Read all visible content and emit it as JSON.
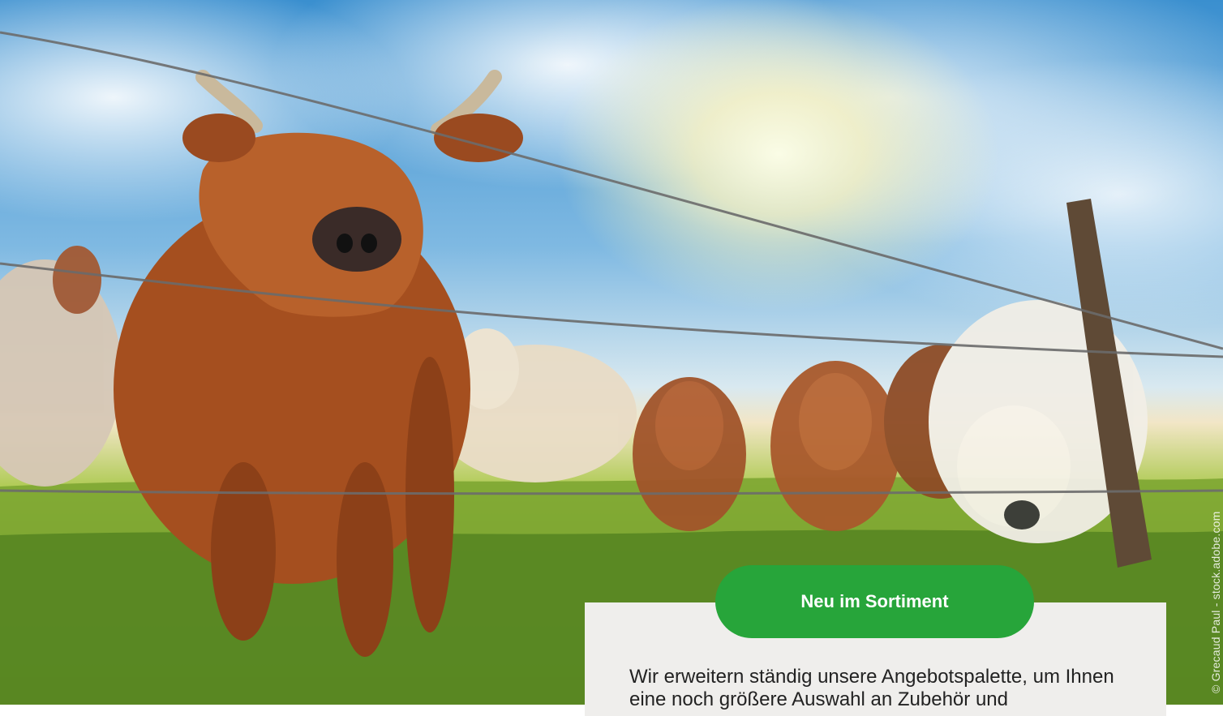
{
  "hero": {
    "image_alt": "Kühe auf einer Weide hinter einem Stacheldrahtzaun bei Sonnenschein",
    "credit": "© Grecaud Paul - stock.adobe.com"
  },
  "badge": {
    "label": "Neu im Sortiment"
  },
  "card": {
    "text": "Wir erweitern ständig unsere Angebotspalette, um Ihnen eine noch größere Auswahl an Zubehör und"
  },
  "colors": {
    "accent_green": "#27a53a",
    "card_background": "#efeeec"
  }
}
